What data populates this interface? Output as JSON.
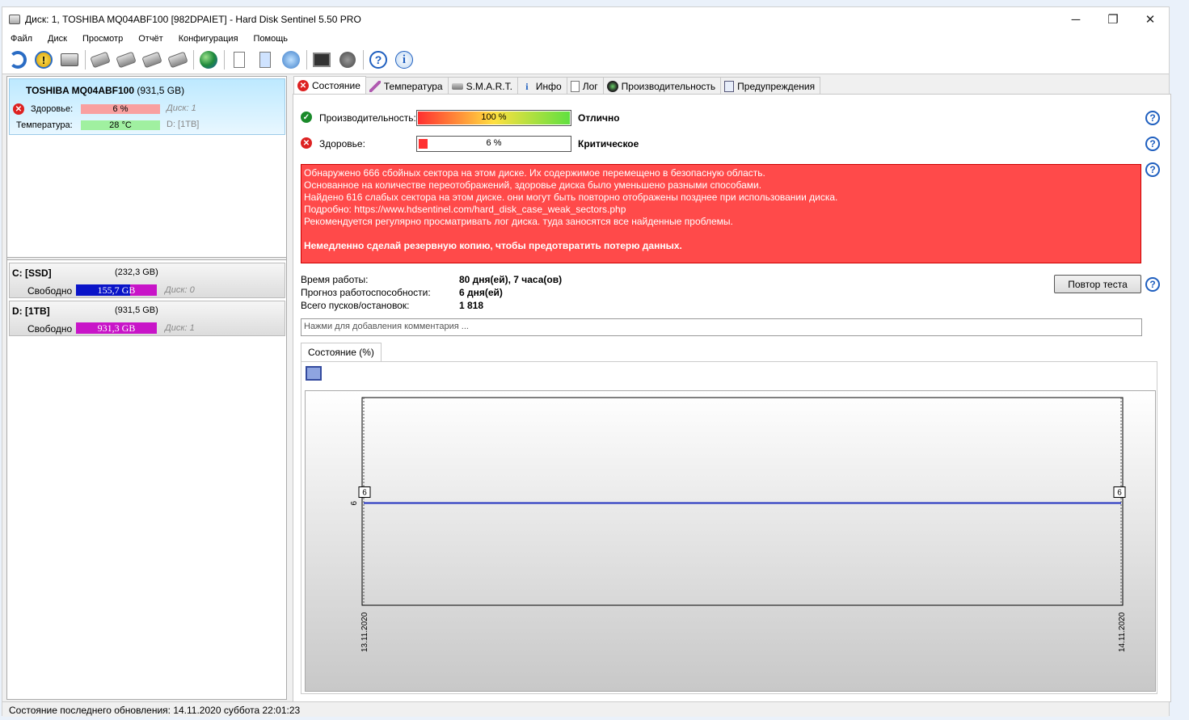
{
  "window": {
    "title": "Диск: 1, TOSHIBA MQ04ABF100 [982DPAIET]  -  Hard Disk Sentinel 5.50 PRO",
    "controls": [
      "─",
      "❐",
      "✕"
    ]
  },
  "menu": [
    "Файл",
    "Диск",
    "Просмотр",
    "Отчёт",
    "Конфигурация",
    "Помощь"
  ],
  "toolbar": {
    "icons": [
      "refresh-icon",
      "warning-icon",
      "drive-icon",
      "disk-icon",
      "disk-icon",
      "disk-check-icon",
      "disk-tool-icon",
      "globe-icon",
      "report-icon",
      "report-send-icon",
      "network-icon",
      "monitor-icon",
      "speaker-icon",
      "help-icon",
      "info-icon"
    ]
  },
  "disk": {
    "name": "TOSHIBA MQ04ABF100",
    "size": "(931,5 GB)",
    "health_label": "Здоровье:",
    "health_value": "6 %",
    "health_percent": 6,
    "health_disk": "Диск: 1",
    "temp_label": "Температура:",
    "temp_value": "28 °C",
    "temp_disk": "D: [1TB]"
  },
  "volumes": [
    {
      "name": "C: [SSD]",
      "size": "(232,3 GB)",
      "free_label": "Свободно",
      "free_value": "155,7 GB",
      "free_fraction": 0.67,
      "disk": "Диск: 0",
      "color": "#0a14c8"
    },
    {
      "name": "D: [1TB]",
      "size": "(931,5 GB)",
      "free_label": "Свободно",
      "free_value": "931,3 GB",
      "free_fraction": 1.0,
      "disk": "Диск: 1",
      "color": "#c814c8"
    }
  ],
  "tabs": [
    {
      "label": "Состояние",
      "icon": "error-icon"
    },
    {
      "label": "Температура",
      "icon": "thermometer-icon"
    },
    {
      "label": "S.M.A.R.T.",
      "icon": "smart-icon"
    },
    {
      "label": "Инфо",
      "icon": "info-icon"
    },
    {
      "label": "Лог",
      "icon": "log-icon"
    },
    {
      "label": "Производительность",
      "icon": "performance-icon"
    },
    {
      "label": "Предупреждения",
      "icon": "alerts-icon"
    }
  ],
  "status": {
    "performance_label": "Производительность:",
    "performance_value": "100 %",
    "performance_percent": 100,
    "performance_rating": "Отлично",
    "health_label": "Здоровье:",
    "health_value": "6 %",
    "health_percent": 6,
    "health_rating": "Критическое"
  },
  "alert": {
    "lines": [
      "Обнаружено 666 сбойных сектора на этом диске. Их содержимое перемещено в безопасную область.",
      "Основанное на количестве переотображений, здоровье диска было уменьшено разными способами.",
      "Найдено 616 слабых сектора на этом диске. они могут быть повторно отображены позднее при использовании диска.",
      "Подробно: https://www.hdsentinel.com/hard_disk_case_weak_sectors.php",
      "Рекомендуется регулярно просматривать лог диска. туда заносятся все найденные проблемы."
    ],
    "bold_line": "Немедленно сделай резервную копию, чтобы предотвратить потерю данных."
  },
  "stats": {
    "uptime_label": "Время работы:",
    "uptime_value": "80 дня(ей), 7 часа(ов)",
    "forecast_label": "Прогноз работоспособности:",
    "forecast_value": "6 дня(ей)",
    "starts_label": "Всего пусков/остановок:",
    "starts_value": "1 818"
  },
  "retest_button": "Повтор теста",
  "comment_placeholder": "Нажми для добавления комментария ...",
  "chart_tab": "Состояние (%)",
  "chart_data": {
    "type": "line",
    "x": [
      "13.11.2020",
      "14.11.2020"
    ],
    "series": [
      {
        "values": [
          6,
          6
        ]
      }
    ],
    "y_tick": "6",
    "data_labels": [
      "6",
      "6"
    ],
    "line_color": "#1f2fbf"
  },
  "statusbar": "Состояние последнего обновления: 14.11.2020 суббота 22:01:23"
}
